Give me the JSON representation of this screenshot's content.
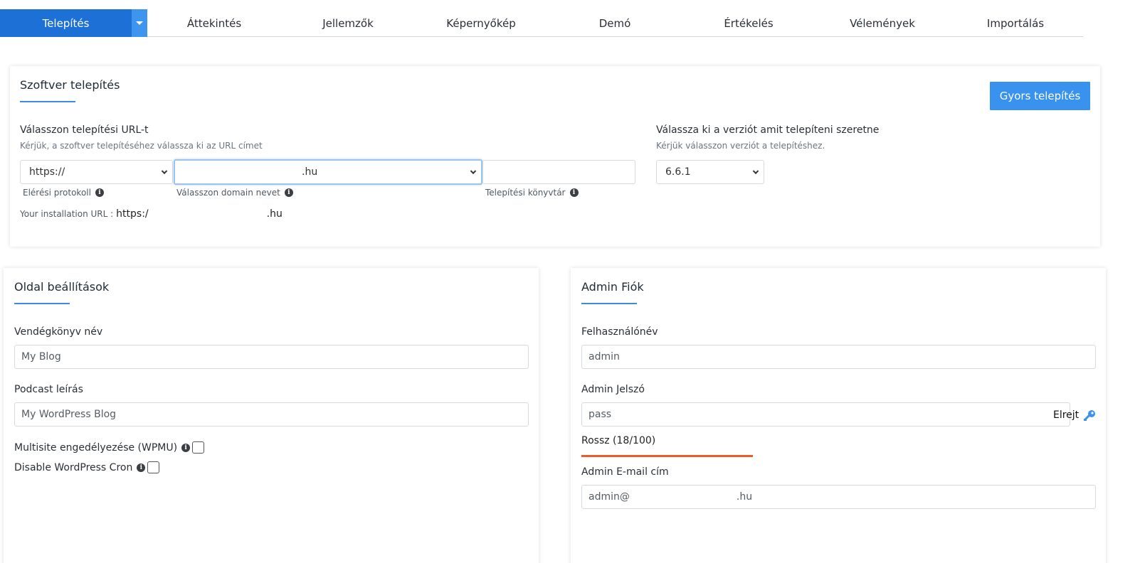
{
  "tabs": {
    "active": "Telepítés",
    "items": [
      "Áttekintés",
      "Jellemzők",
      "Képernyőkép",
      "Demó",
      "Értékelés",
      "Vélemények",
      "Importálás"
    ]
  },
  "install": {
    "title": "Szoftver telepítés",
    "quick_install_label": "Gyors telepítés",
    "url_heading": "Válasszon telepítési URL-t",
    "url_hint": "Kérjük, a szoftver telepítéséhez válassza ki az URL címet",
    "protocol_value": "https://",
    "domain_value": ".hu",
    "directory_value": "",
    "protocol_label": "Elérési protokoll",
    "domain_label": "Válasszon domain nevet",
    "directory_label": "Telepítési könyvtár",
    "install_url_prefix": "Your installation URL :",
    "install_url_start": "https:/",
    "install_url_end": ".hu",
    "version_heading": "Válassza ki a verziót amit telepíteni szeretne",
    "version_hint": "Kérjük válasszon verziót a telepítéshez.",
    "version_value": "6.6.1"
  },
  "site": {
    "title": "Oldal beállítások",
    "name_label": "Vendégkönyv név",
    "name_value": "My Blog",
    "desc_label": "Podcast leírás",
    "desc_value": "My WordPress Blog",
    "multisite_label": "Multisite engedélyezése (WPMU)",
    "cron_label": "Disable WordPress Cron"
  },
  "admin": {
    "title": "Admin Fiók",
    "username_label": "Felhasználónév",
    "username_value": "admin",
    "password_label": "Admin Jelszó",
    "password_value": "pass",
    "hide_label": "Elrejt",
    "strength_text": "Rossz (18/100)",
    "strength_value": 18,
    "email_label": "Admin E-mail cím",
    "email_start": "admin@",
    "email_end": ".hu"
  },
  "colors": {
    "accent": "#1d70d6",
    "button": "#3892ee",
    "strength_bar": "#f05a28"
  }
}
